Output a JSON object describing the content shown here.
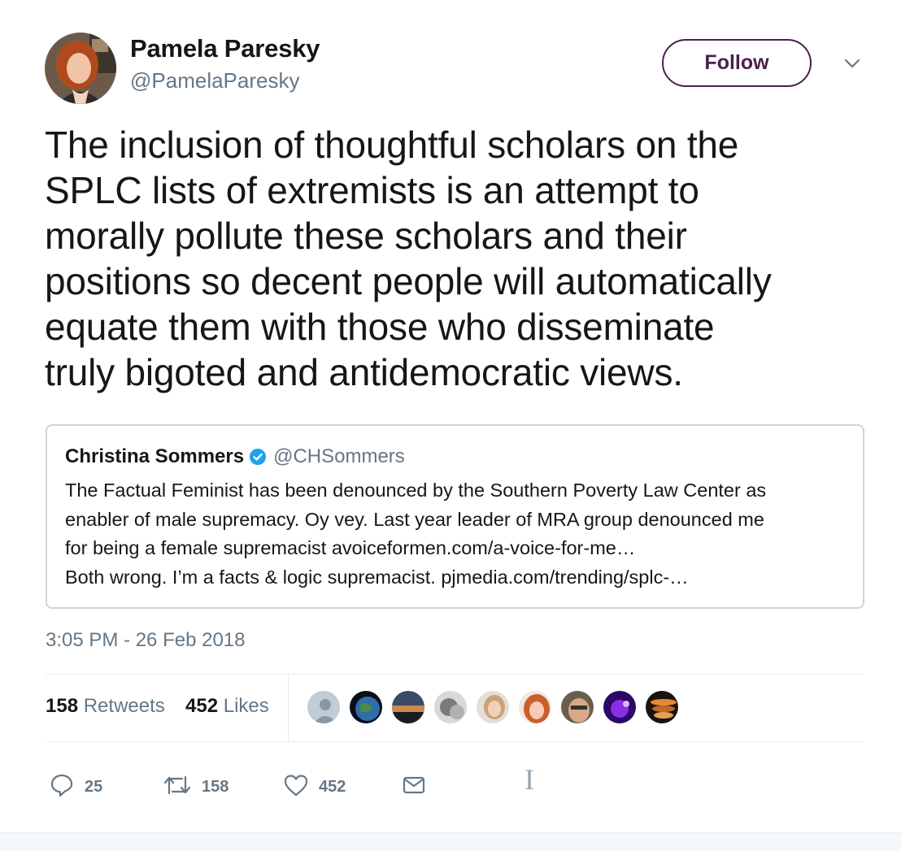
{
  "author": {
    "display_name": "Pamela Paresky",
    "handle": "@PamelaParesky",
    "follow_label": "Follow"
  },
  "tweet": {
    "lines": [
      "The inclusion of thoughtful scholars on the",
      "SPLC lists of extremists is an attempt to",
      "morally pollute these scholars and their",
      "positions so decent people will automatically",
      "equate them with those who disseminate",
      "truly bigoted and antidemocratic views."
    ]
  },
  "quoted": {
    "display_name": "Christina Sommers",
    "handle": "@CHSommers",
    "lines": [
      "The Factual Feminist has been denounced by the Southern Poverty Law Center as",
      "enabler of male supremacy. Oy vey.  Last year leader of MRA group denounced me",
      "for being a female supremacist avoiceformen.com/a-voice-for-me…",
      "Both wrong. I’m a facts & logic supremacist. pjmedia.com/trending/splc-…"
    ]
  },
  "timestamp": "3:05 PM - 26 Feb 2018",
  "stats": {
    "retweets_count": "158",
    "retweets_label": "Retweets",
    "likes_count": "452",
    "likes_label": "Likes"
  },
  "actions": {
    "reply_count": "25",
    "retweet_count": "158",
    "like_count": "452"
  },
  "icons": [
    "reply-icon",
    "retweet-icon",
    "heart-icon",
    "mail-icon",
    "verified-badge-icon",
    "chevron-down-icon"
  ],
  "colors": {
    "follow_accent": "#4a1f4e",
    "secondary_text": "#657786",
    "verified_blue": "#1da1f2",
    "border": "#ccd6dd"
  }
}
